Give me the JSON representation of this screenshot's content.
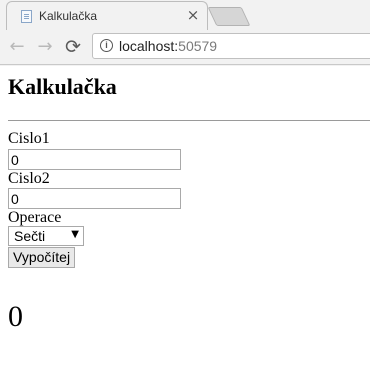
{
  "browser": {
    "tab_title": "Kalkulačka",
    "tab_close": "×",
    "url_host": "localhost:",
    "url_port": "50579",
    "nav_back": "←",
    "nav_forward": "→",
    "nav_reload": "⟳",
    "info_icon": "i"
  },
  "page": {
    "title": "Kalkulačka",
    "fields": [
      {
        "label": "Cislo1",
        "value": "0"
      },
      {
        "label": "Cislo2",
        "value": "0"
      }
    ],
    "operation": {
      "label": "Operace",
      "selected": "Sečti",
      "arrow": "▼"
    },
    "submit_label": "Vypočítej",
    "result": "0"
  }
}
